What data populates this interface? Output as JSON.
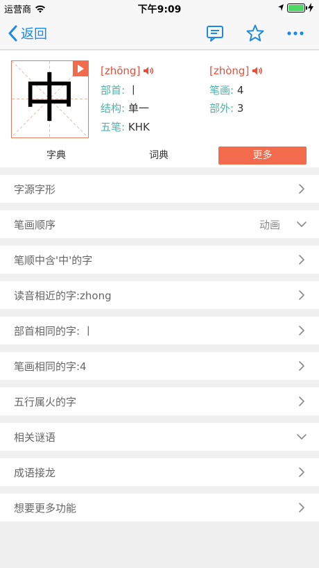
{
  "status": {
    "carrier": "运营商",
    "time": "下午9:09",
    "battery_level": 1.0
  },
  "nav": {
    "back_label": "返回",
    "icons": [
      "comment-icon",
      "star-icon",
      "more-icon"
    ]
  },
  "character": {
    "glyph": "中",
    "pinyin_1": "[zhōng]",
    "pinyin_2": "[zhòng]",
    "radical_label": "部首:",
    "radical_value": "丨",
    "strokes_label": "笔画:",
    "strokes_value": "4",
    "structure_label": "结构:",
    "structure_value": "单一",
    "outside_label": "部外:",
    "outside_value": "3",
    "wubi_label": "五笔:",
    "wubi_value": "KHK"
  },
  "tabs": [
    {
      "label": "字典"
    },
    {
      "label": "词典"
    },
    {
      "label": "更多",
      "active": true
    }
  ],
  "rows": [
    {
      "label": "字源字形",
      "right": "",
      "icon": "chevron-right"
    },
    {
      "label": "笔画顺序",
      "right": "动画",
      "icon": "chevron-down"
    },
    {
      "label": "笔顺中含'中'的字",
      "right": "",
      "icon": "chevron-right"
    },
    {
      "label": "读音相近的字:zhong",
      "right": "",
      "icon": "chevron-right"
    },
    {
      "label": "部首相同的字: 丨",
      "right": "",
      "icon": "chevron-right"
    },
    {
      "label": "笔画相同的字:4",
      "right": "",
      "icon": "chevron-right"
    },
    {
      "label": "五行属火的字",
      "right": "",
      "icon": "chevron-right"
    },
    {
      "label": "相关谜语",
      "right": "",
      "icon": "chevron-down"
    },
    {
      "label": "成语接龙",
      "right": "",
      "icon": "chevron-right"
    },
    {
      "label": "想要更多功能",
      "right": "",
      "icon": "chevron-right"
    }
  ],
  "colors": {
    "accent": "#f26b4d",
    "link": "#1e88e5",
    "label_teal": "#4fb3a8",
    "pinyin_red": "#e94e3a"
  }
}
